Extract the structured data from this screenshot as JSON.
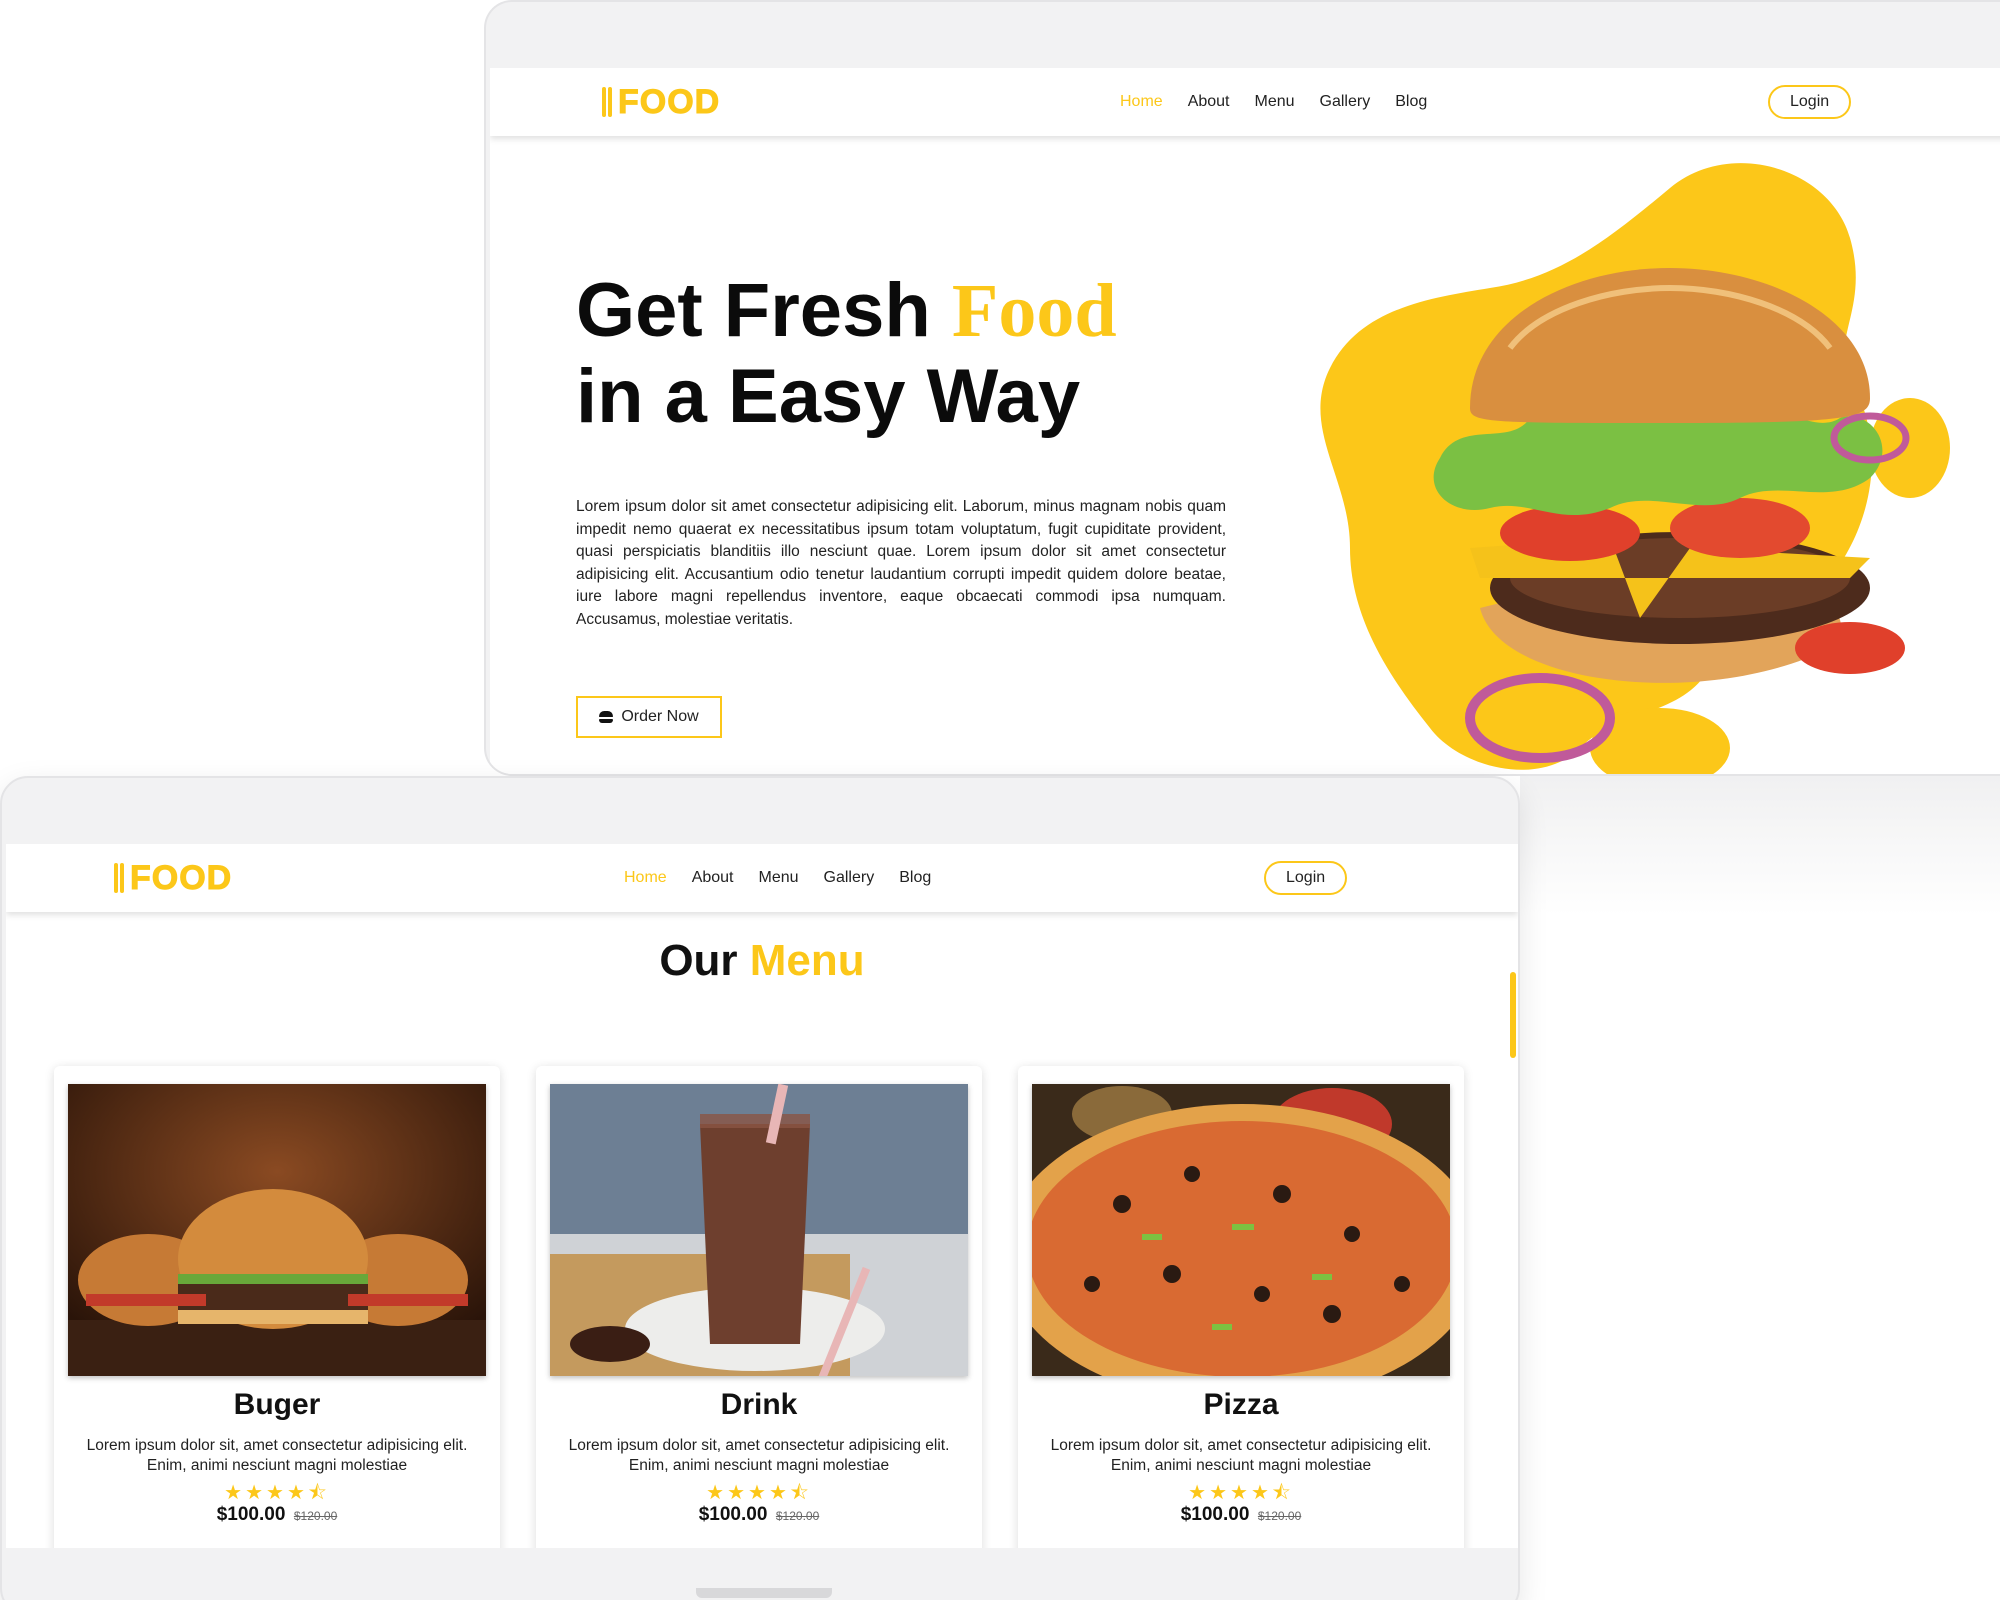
{
  "brand": {
    "logo_text": "FOOD"
  },
  "nav": {
    "links": [
      "Home",
      "About",
      "Menu",
      "Gallery",
      "Blog"
    ],
    "active": "Home",
    "login_label": "Login"
  },
  "hero": {
    "title_part1": "Get Fresh ",
    "title_accent": "Food",
    "title_line2": "in a Easy Way",
    "paragraph": "Lorem ipsum dolor sit amet consectetur adipisicing elit. Laborum, minus magnam nobis quam impedit nemo quaerat ex necessitatibus ipsum totam voluptatum, fugit cupiditate provident, quasi perspiciatis blanditiis illo nesciunt quae. Lorem ipsum dolor sit amet consectetur adipisicing elit. Accusantium odio tenetur laudantium corrupti impedit quidem dolore beatae, iure labore magni repellendus inventore, eaque obcaecati commodi ipsa numquam. Accusamus, molestiae veritatis.",
    "order_label": "Order Now"
  },
  "menu_section": {
    "title_part1": "Our ",
    "title_accent": "Menu",
    "items": [
      {
        "name": "Buger",
        "description": "Lorem ipsum dolor sit, amet consectetur adipisicing elit. Enim, animi nesciunt magni molestiae",
        "stars": "★★★★⯪",
        "rating": 4.5,
        "price": "$100.00",
        "old_price": "$120.00"
      },
      {
        "name": "Drink",
        "description": "Lorem ipsum dolor sit, amet consectetur adipisicing elit. Enim, animi nesciunt magni molestiae",
        "stars": "★★★★⯪",
        "rating": 4.5,
        "price": "$100.00",
        "old_price": "$120.00"
      },
      {
        "name": "Pizza",
        "description": "Lorem ipsum dolor sit, amet consectetur adipisicing elit. Enim, animi nesciunt magni molestiae",
        "stars": "★★★★⯪",
        "rating": 4.5,
        "price": "$100.00",
        "old_price": "$120.00"
      }
    ]
  },
  "colors": {
    "accent": "#fcc719",
    "text": "#111111",
    "frame": "#f2f2f3"
  },
  "icons": {
    "order_button": "burger-icon",
    "logo": "fork-knife-icon",
    "stars": "star-icon"
  }
}
